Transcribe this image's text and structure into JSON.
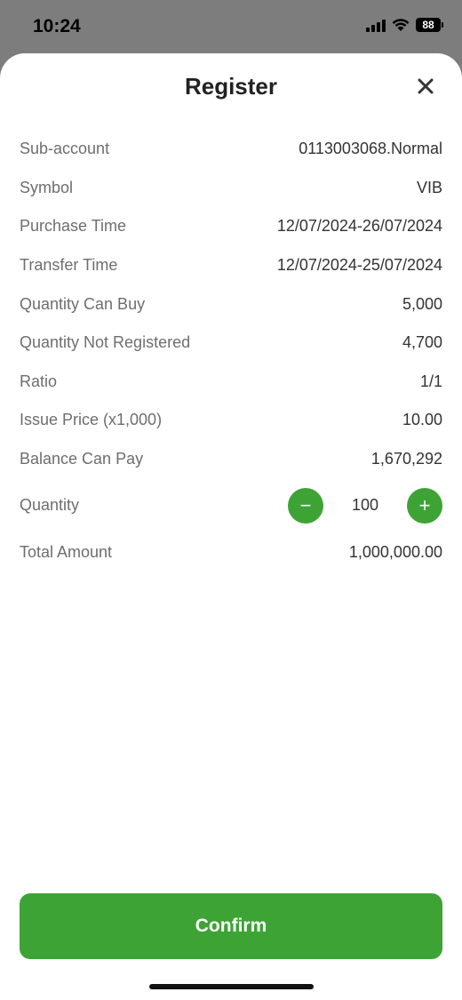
{
  "status_bar": {
    "time": "10:24",
    "battery": "88",
    "icons": [
      "cellular-signal-icon",
      "wifi-icon",
      "battery-icon"
    ]
  },
  "sheet": {
    "title": "Register",
    "close_icon": "close-icon"
  },
  "details": [
    {
      "label": "Sub-account",
      "value": "0113003068.Normal"
    },
    {
      "label": "Symbol",
      "value": "VIB"
    },
    {
      "label": "Purchase Time",
      "value": "12/07/2024-26/07/2024"
    },
    {
      "label": "Transfer Time",
      "value": "12/07/2024-25/07/2024"
    },
    {
      "label": "Quantity Can Buy",
      "value": "5,000"
    },
    {
      "label": "Quantity Not Registered",
      "value": "4,700"
    },
    {
      "label": "Ratio",
      "value": "1/1"
    },
    {
      "label": "Issue Price (x1,000)",
      "value": "10.00"
    },
    {
      "label": "Balance Can Pay",
      "value": "1,670,292"
    }
  ],
  "quantity": {
    "label": "Quantity",
    "value": "100",
    "decrement_symbol": "−",
    "increment_symbol": "+"
  },
  "total": {
    "label": "Total Amount",
    "value": "1,000,000.00"
  },
  "confirm_label": "Confirm",
  "colors": {
    "accent": "#3da335",
    "label": "#6e6e6e",
    "value": "#333333",
    "backdrop": "#7d7d7d"
  }
}
